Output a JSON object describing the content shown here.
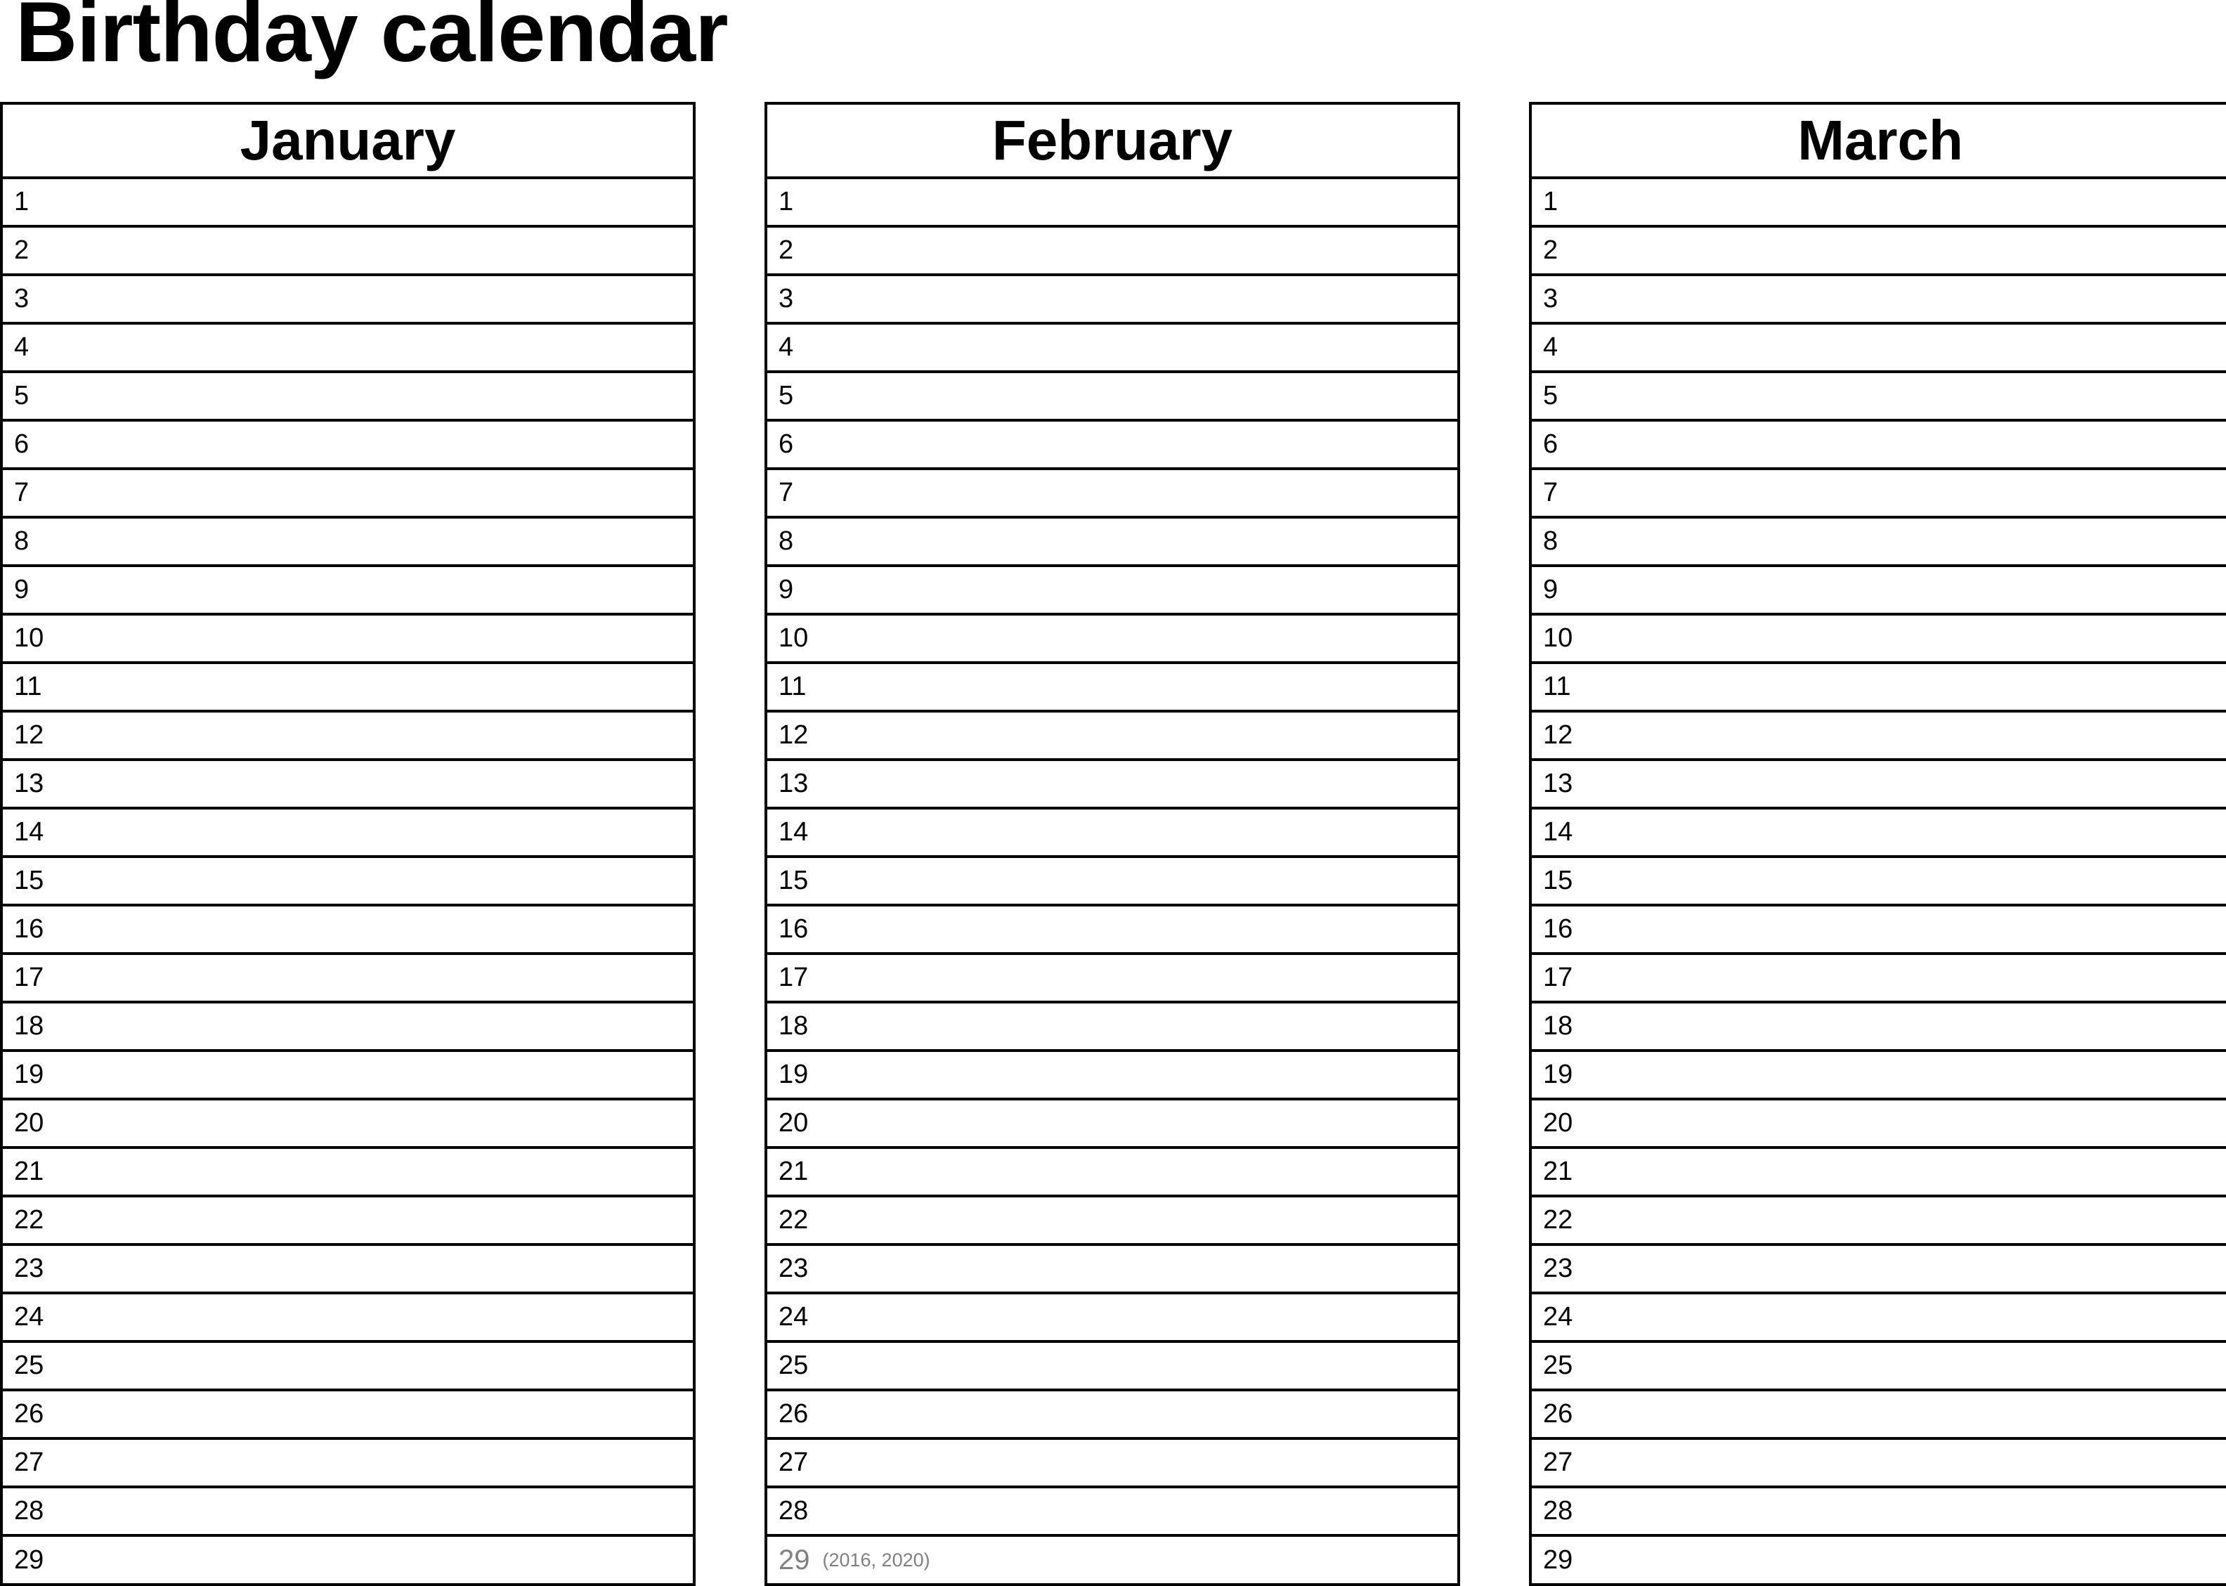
{
  "title": "Birthday calendar",
  "months": [
    {
      "name": "January",
      "days": [
        "1",
        "2",
        "3",
        "4",
        "5",
        "6",
        "7",
        "8",
        "9",
        "10",
        "11",
        "12",
        "13",
        "14",
        "15",
        "16",
        "17",
        "18",
        "19",
        "20",
        "21",
        "22",
        "23",
        "24",
        "25",
        "26",
        "27",
        "28",
        "29"
      ]
    },
    {
      "name": "February",
      "days": [
        "1",
        "2",
        "3",
        "4",
        "5",
        "6",
        "7",
        "8",
        "9",
        "10",
        "11",
        "12",
        "13",
        "14",
        "15",
        "16",
        "17",
        "18",
        "19",
        "20",
        "21",
        "22",
        "23",
        "24",
        "25",
        "26",
        "27",
        "28",
        "29"
      ],
      "leap_day": {
        "day": "29",
        "note": "(2016, 2020)"
      }
    },
    {
      "name": "March",
      "days": [
        "1",
        "2",
        "3",
        "4",
        "5",
        "6",
        "7",
        "8",
        "9",
        "10",
        "11",
        "12",
        "13",
        "14",
        "15",
        "16",
        "17",
        "18",
        "19",
        "20",
        "21",
        "22",
        "23",
        "24",
        "25",
        "26",
        "27",
        "28",
        "29"
      ]
    }
  ],
  "colors": {
    "text": "#000000",
    "muted": "#808080",
    "border": "#000000"
  }
}
